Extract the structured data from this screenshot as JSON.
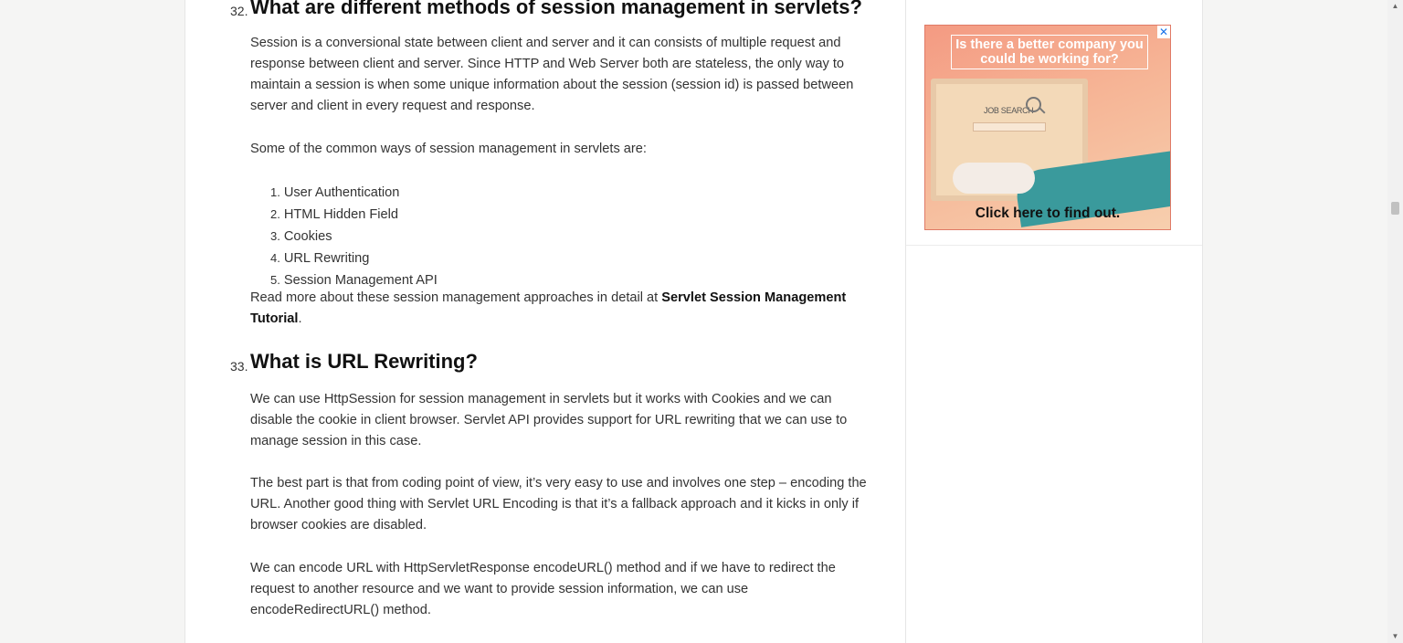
{
  "article": {
    "q32": {
      "number": "32.",
      "title": "What are different methods of session management in servlets?",
      "para1": "Session is a conversional state between client and server and it can consists of multiple request and response between client and server. Since HTTP and Web Server both are stateless, the only way to maintain a session is when some unique information about the session (session id) is passed between server and client in every request and response.",
      "para2": "Some of the common ways of session management in servlets are:",
      "list": [
        {
          "num": "1.",
          "text": "User Authentication"
        },
        {
          "num": "2.",
          "text": "HTML Hidden Field"
        },
        {
          "num": "3.",
          "text": "Cookies"
        },
        {
          "num": "4.",
          "text": "URL Rewriting"
        },
        {
          "num": "5.",
          "text": "Session Management API"
        }
      ],
      "readmore_prefix": "Read more about these session management approaches in detail at ",
      "readmore_link": "Servlet Session Management Tutorial",
      "readmore_suffix": "."
    },
    "q33": {
      "number": "33.",
      "title": "What is URL Rewriting?",
      "para1": "We can use HttpSession for session management in servlets but it works with Cookies and we can disable the cookie in client browser. Servlet API provides support for URL rewriting that we can use to manage session in this case.",
      "para2": "The best part is that from coding point of view, it’s very easy to use and involves one step – encoding the URL. Another good thing with Servlet URL Encoding is that it’s a fallback approach and it kicks in only if browser cookies are disabled.",
      "para3": "We can encode URL with HttpServletResponse encodeURL() method and if we have to redirect the request to another resource and we want to provide session information, we can use encodeRedirectURL() method."
    }
  },
  "ad": {
    "headline": "Is there a better company you could be working for?",
    "screen_text": "JOB SEARCH",
    "cta": "Click here to find out.",
    "close_icon": "close-icon"
  },
  "colors": {
    "page_bg": "#f5f5f4",
    "content_bg": "#ffffff",
    "text": "#333333",
    "heading": "#111111",
    "ad_accent": "#f49a82",
    "ad_teal": "#3a9a9c"
  }
}
